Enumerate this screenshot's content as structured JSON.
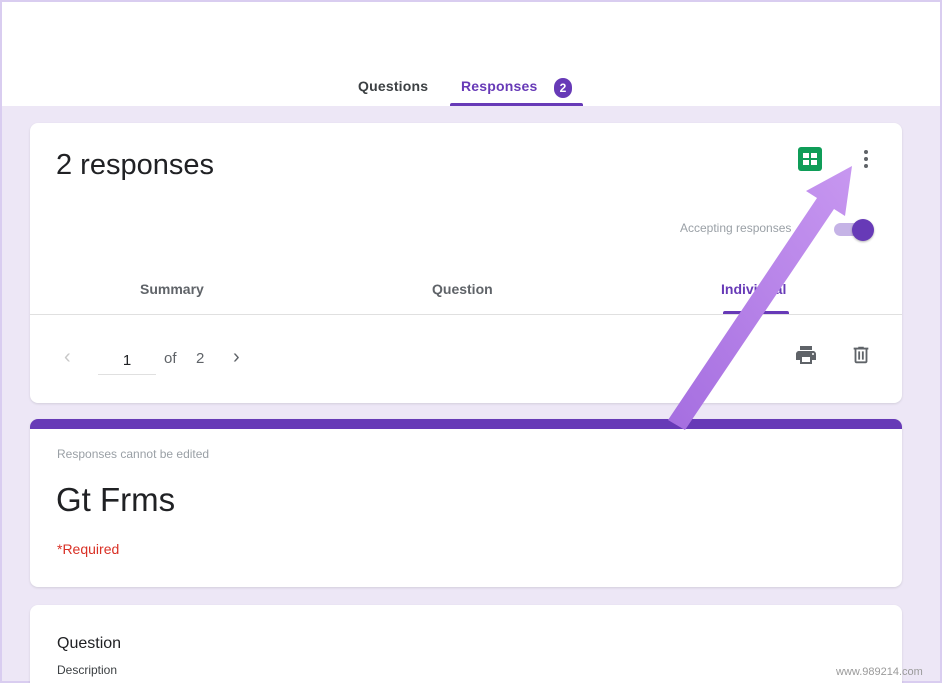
{
  "header": {
    "tabs": {
      "questions_label": "Questions",
      "responses_label": "Responses",
      "responses_badge": "2"
    }
  },
  "summary_card": {
    "title": "2 responses",
    "sheets_icon": "google-sheets-icon",
    "more_icon": "more-vert-icon",
    "accepting_label": "Accepting responses",
    "accepting_on": true,
    "tabs": {
      "summary_label": "Summary",
      "question_label": "Question",
      "individual_label": "Individual"
    },
    "pager": {
      "prev_icon": "chevron-left-icon",
      "current": "1",
      "of_label": "of",
      "total": "2",
      "next_icon": "chevron-right-icon"
    },
    "print_icon": "print-icon",
    "delete_icon": "trash-icon"
  },
  "form_header": {
    "locked_note": "Responses cannot be edited",
    "title": "Gt Frms",
    "required_note": "*Required"
  },
  "question_card": {
    "title": "Question",
    "description": "Description"
  },
  "watermark": "www.989214.com",
  "colors": {
    "accent": "#673ab7",
    "page_background": "#ede7f6",
    "sheets_green": "#0f9d58",
    "required_red": "#d93025",
    "annotation_arrow": "#b57ee8"
  }
}
